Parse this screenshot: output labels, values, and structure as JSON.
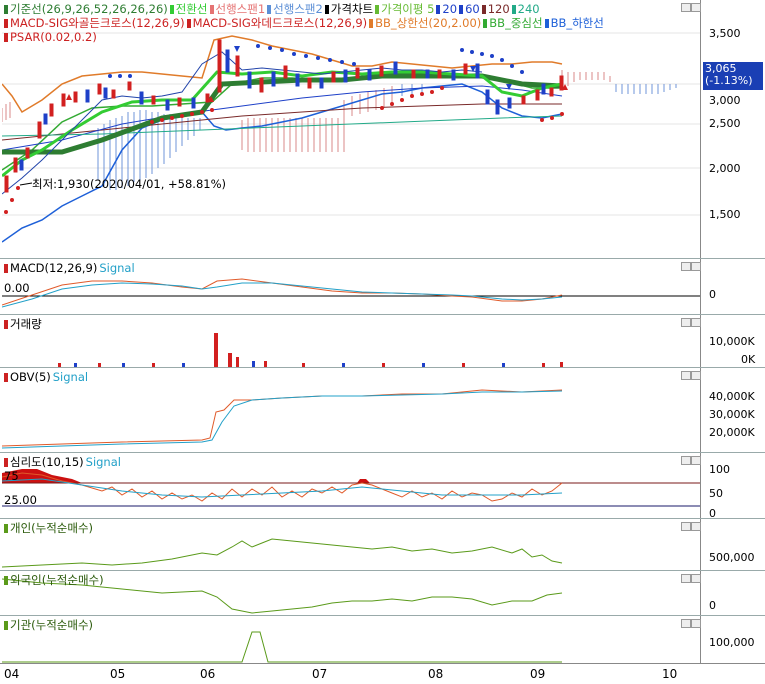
{
  "main_pane": {
    "legend_line1": [
      {
        "label": "기준선(26,9,26,52,26,26,26)",
        "color": "#2e7d32"
      },
      {
        "label": "전환선",
        "color": "#33cc33"
      },
      {
        "label": "선행스팬1",
        "color": "#e57373"
      },
      {
        "label": "선행스팬2",
        "color": "#5c8fd6"
      },
      {
        "label": "가격차트",
        "color": "#000000"
      },
      {
        "label": "가격이평 5",
        "color": "#66bb33"
      },
      {
        "label": "20",
        "color": "#1e40c8"
      },
      {
        "label": "60",
        "color": "#1e40c8"
      },
      {
        "label": "120",
        "color": "#7a2a2a"
      },
      {
        "label": "240",
        "color": "#22aa88"
      }
    ],
    "legend_line2": [
      {
        "label": "MACD-SIG와골든크로스(12,26,9)",
        "color": "#cc2222"
      },
      {
        "label": "MACD-SIG와데드크로스(12,26,9)",
        "color": "#cc2222"
      },
      {
        "label": "BB_상한선(20,2.00)",
        "color": "#e07b2a"
      },
      {
        "label": "BB_중심선",
        "color": "#33aa33"
      },
      {
        "label": "BB_하한선",
        "color": "#1e60d8"
      }
    ],
    "legend_line3": [
      {
        "label": "PSAR(0.02,0.2)",
        "color": "#cc2222"
      }
    ],
    "annotation_low": "최저:1,930(2020/04/01, +58.81%)",
    "price_box": {
      "price": "3,065",
      "change": "(-1.13%)"
    },
    "y_ticks": [
      "3,500",
      "3,000",
      "2,500",
      "2,000",
      "1,500"
    ]
  },
  "macd_pane": {
    "title": "MACD(12,26,9)",
    "signal": "Signal",
    "left_value": "0.00",
    "y_ticks": [
      "0"
    ]
  },
  "volume_pane": {
    "title": "거래량",
    "y_ticks": [
      "10,000K",
      "0K"
    ]
  },
  "obv_pane": {
    "title": "OBV(5)",
    "signal": "Signal",
    "y_ticks": [
      "40,000K",
      "30,000K",
      "20,000K"
    ]
  },
  "psy_pane": {
    "title": "심리도(10,15)",
    "signal": "Signal",
    "level_high": "75",
    "level_low": "25.00",
    "y_ticks": [
      "100",
      "50",
      "0"
    ]
  },
  "retail_pane": {
    "title": "개인(누적순매수)",
    "y_ticks": [
      "500,000"
    ]
  },
  "foreign_pane": {
    "title": "외국인(누적순매수)",
    "y_ticks": [
      "0"
    ]
  },
  "inst_pane": {
    "title": "기관(누적순매수)",
    "y_ticks": [
      "100,000"
    ]
  },
  "x_axis": {
    "months": [
      "04",
      "05",
      "06",
      "07",
      "08",
      "09",
      "10"
    ]
  },
  "colors": {
    "up": "#d22020",
    "down": "#1e40c8",
    "price_box": "#1a3fb4"
  }
}
